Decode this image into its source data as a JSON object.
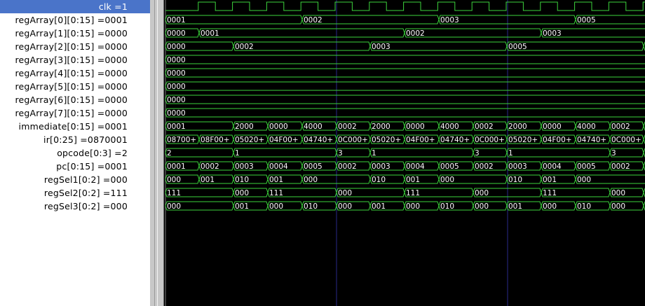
{
  "colors": {
    "wave": "#3cd43c",
    "wave_text": "#ffffff",
    "background": "#000000",
    "marker": "#2a2a8a",
    "selected": "#4a74c9"
  },
  "signals": [
    {
      "name": "clk",
      "value": "1",
      "label": "clk =1",
      "type": "clock"
    },
    {
      "name": "regArray[0][0:15]",
      "label": "regArray[0][0:15] =0001",
      "type": "bus",
      "segments": [
        [
          "0001",
          0,
          195
        ],
        [
          "0002",
          195,
          390
        ],
        [
          "0003",
          390,
          585
        ],
        [
          "0005",
          585,
          686
        ]
      ]
    },
    {
      "name": "regArray[1][0:15]",
      "label": "regArray[1][0:15] =0000",
      "type": "bus",
      "segments": [
        [
          "0000",
          0,
          48
        ],
        [
          "0001",
          48,
          341
        ],
        [
          "0002",
          341,
          536
        ],
        [
          "0003",
          536,
          686
        ]
      ]
    },
    {
      "name": "regArray[2][0:15]",
      "label": "regArray[2][0:15] =0000",
      "type": "bus",
      "segments": [
        [
          "0000",
          0,
          97
        ],
        [
          "0002",
          97,
          292
        ],
        [
          "0003",
          292,
          487
        ],
        [
          "0005",
          487,
          682
        ],
        [
          "",
          682,
          686
        ]
      ]
    },
    {
      "name": "regArray[3][0:15]",
      "label": "regArray[3][0:15] =0000",
      "type": "bus",
      "segments": [
        [
          "0000",
          0,
          686
        ]
      ]
    },
    {
      "name": "regArray[4][0:15]",
      "label": "regArray[4][0:15] =0000",
      "type": "bus",
      "segments": [
        [
          "0000",
          0,
          686
        ]
      ]
    },
    {
      "name": "regArray[5][0:15]",
      "label": "regArray[5][0:15] =0000",
      "type": "bus",
      "segments": [
        [
          "0000",
          0,
          686
        ]
      ]
    },
    {
      "name": "regArray[6][0:15]",
      "label": "regArray[6][0:15] =0000",
      "type": "bus",
      "segments": [
        [
          "0000",
          0,
          686
        ]
      ]
    },
    {
      "name": "regArray[7][0:15]",
      "label": "regArray[7][0:15] =0000",
      "type": "bus",
      "segments": [
        [
          "0000",
          0,
          686
        ]
      ]
    },
    {
      "name": "immediate[0:15]",
      "label": "immediate[0:15] =0001",
      "type": "bus",
      "segments": [
        [
          "0001",
          0,
          97
        ],
        [
          "2000",
          97,
          146
        ],
        [
          "0000",
          146,
          195
        ],
        [
          "4000",
          195,
          244
        ],
        [
          "0002",
          244,
          292
        ],
        [
          "2000",
          292,
          341
        ],
        [
          "0000",
          341,
          390
        ],
        [
          "4000",
          390,
          439
        ],
        [
          "0002",
          439,
          487
        ],
        [
          "2000",
          487,
          536
        ],
        [
          "0000",
          536,
          585
        ],
        [
          "4000",
          585,
          634
        ],
        [
          "0002",
          634,
          682
        ],
        [
          "",
          682,
          686
        ]
      ]
    },
    {
      "name": "ir[0:25]",
      "label": "ir[0:25] =0870001",
      "type": "bus",
      "segments": [
        [
          "08700+",
          0,
          48
        ],
        [
          "08F00+",
          48,
          97
        ],
        [
          "05020+",
          97,
          146
        ],
        [
          "04F00+",
          146,
          195
        ],
        [
          "04740+",
          195,
          244
        ],
        [
          "0C000+",
          244,
          292
        ],
        [
          "05020+",
          292,
          341
        ],
        [
          "04F00+",
          341,
          390
        ],
        [
          "04740+",
          390,
          439
        ],
        [
          "0C000+",
          439,
          487
        ],
        [
          "05020+",
          487,
          536
        ],
        [
          "04F00+",
          536,
          585
        ],
        [
          "04740+",
          585,
          634
        ],
        [
          "0C000+",
          634,
          682
        ],
        [
          "",
          682,
          686
        ]
      ]
    },
    {
      "name": "opcode[0:3]",
      "label": "opcode[0:3] =2",
      "type": "bus",
      "segments": [
        [
          "2",
          0,
          97
        ],
        [
          "1",
          97,
          244
        ],
        [
          "3",
          244,
          292
        ],
        [
          "1",
          292,
          439
        ],
        [
          "3",
          439,
          487
        ],
        [
          "1",
          487,
          634
        ],
        [
          "3",
          634,
          682
        ],
        [
          "",
          682,
          686
        ]
      ]
    },
    {
      "name": "pc[0:15]",
      "label": "pc[0:15] =0001",
      "type": "bus",
      "segments": [
        [
          "0001",
          0,
          48
        ],
        [
          "0002",
          48,
          97
        ],
        [
          "0003",
          97,
          146
        ],
        [
          "0004",
          146,
          195
        ],
        [
          "0005",
          195,
          244
        ],
        [
          "0002",
          244,
          292
        ],
        [
          "0003",
          292,
          341
        ],
        [
          "0004",
          341,
          390
        ],
        [
          "0005",
          390,
          439
        ],
        [
          "0002",
          439,
          487
        ],
        [
          "0003",
          487,
          536
        ],
        [
          "0004",
          536,
          585
        ],
        [
          "0005",
          585,
          634
        ],
        [
          "0002",
          634,
          682
        ],
        [
          "",
          682,
          686
        ]
      ]
    },
    {
      "name": "regSel1[0:2]",
      "label": "regSel1[0:2] =000",
      "type": "bus",
      "segments": [
        [
          "000",
          0,
          48
        ],
        [
          "001",
          48,
          97
        ],
        [
          "010",
          97,
          146
        ],
        [
          "001",
          146,
          195
        ],
        [
          "000",
          195,
          292
        ],
        [
          "010",
          292,
          341
        ],
        [
          "001",
          341,
          390
        ],
        [
          "000",
          390,
          487
        ],
        [
          "010",
          487,
          536
        ],
        [
          "001",
          536,
          585
        ],
        [
          "000",
          585,
          686
        ]
      ]
    },
    {
      "name": "regSel2[0:2]",
      "label": "regSel2[0:2] =111",
      "type": "bus",
      "segments": [
        [
          "111",
          0,
          97
        ],
        [
          "000",
          97,
          146
        ],
        [
          "111",
          146,
          244
        ],
        [
          "000",
          244,
          341
        ],
        [
          "111",
          341,
          439
        ],
        [
          "000",
          439,
          536
        ],
        [
          "111",
          536,
          634
        ],
        [
          "000",
          634,
          682
        ],
        [
          "",
          682,
          686
        ]
      ]
    },
    {
      "name": "regSel3[0:2]",
      "label": "regSel3[0:2] =000",
      "type": "bus",
      "segments": [
        [
          "000",
          0,
          97
        ],
        [
          "001",
          97,
          146
        ],
        [
          "000",
          146,
          195
        ],
        [
          "010",
          195,
          244
        ],
        [
          "000",
          244,
          292
        ],
        [
          "001",
          292,
          341
        ],
        [
          "000",
          341,
          390
        ],
        [
          "010",
          390,
          439
        ],
        [
          "000",
          439,
          487
        ],
        [
          "001",
          487,
          536
        ],
        [
          "000",
          536,
          585
        ],
        [
          "010",
          585,
          634
        ],
        [
          "000",
          634,
          682
        ],
        [
          "",
          682,
          686
        ]
      ]
    }
  ]
}
